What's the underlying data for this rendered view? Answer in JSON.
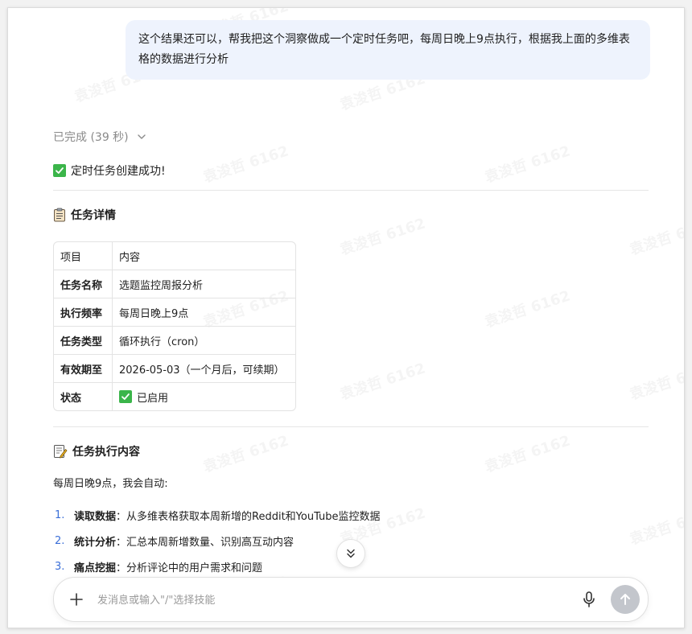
{
  "conversation": {
    "user_message": "这个结果还可以，帮我把这个洞察做成一个定时任务吧，每周日晚上9点执行，根据我上面的多维表格的数据进行分析",
    "assistant": {
      "status": "已完成 (39 秒)",
      "success_text": "定时任务创建成功!",
      "details_title": "任务详情",
      "table": {
        "header": {
          "key": "项目",
          "value": "内容"
        },
        "rows": [
          {
            "key": "任务名称",
            "value": "选题监控周报分析"
          },
          {
            "key": "执行频率",
            "value": "每周日晚上9点"
          },
          {
            "key": "任务类型",
            "value": "循环执行（cron）"
          },
          {
            "key": "有效期至",
            "value": "2026-05-03（一个月后，可续期）"
          },
          {
            "key": "状态",
            "value": "已启用"
          }
        ]
      },
      "exec_title": "任务执行内容",
      "intro": "每周日晚9点，我会自动:",
      "steps": [
        {
          "num": "1.",
          "key": "读取数据",
          "text": "：从多维表格获取本周新增的Reddit和YouTube监控数据"
        },
        {
          "num": "2.",
          "key": "统计分析",
          "text": "：汇总本周新增数量、识别高互动内容"
        },
        {
          "num": "3.",
          "key": "痛点挖掘",
          "text": "：分析评论中的用户需求和问题"
        }
      ]
    }
  },
  "composer": {
    "placeholder": "发消息或输入\"/\"选择技能"
  },
  "watermark": "袁浚哲 6162",
  "colors": {
    "user_bubble": "#eef3fd",
    "success_check": "#3bb54a",
    "list_number": "#3b6fd8",
    "send_button": "#c3c6cc"
  },
  "icons": [
    "chevron-down-icon",
    "check-mark-icon",
    "clipboard-icon",
    "memo-icon",
    "double-chevron-down-icon",
    "plus-icon",
    "microphone-icon",
    "arrow-up-icon"
  ]
}
